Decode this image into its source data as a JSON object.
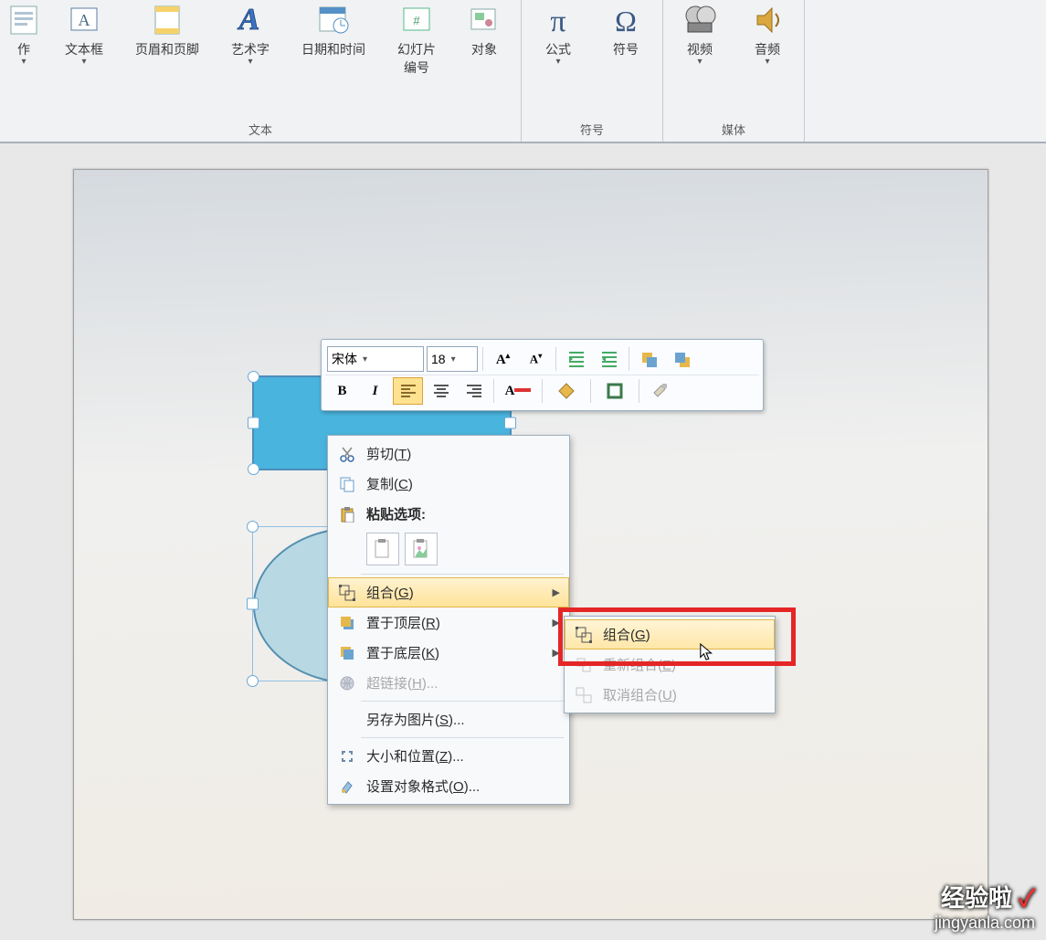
{
  "ribbon": {
    "groups": [
      {
        "label": "文本",
        "items": [
          {
            "label": "作",
            "icon": "action",
            "dd": true
          },
          {
            "label": "文本框",
            "icon": "textbox",
            "dd": true
          },
          {
            "label": "页眉和页脚",
            "icon": "headerfooter"
          },
          {
            "label": "艺术字",
            "icon": "wordart",
            "dd": true
          },
          {
            "label": "日期和时间",
            "icon": "datetime"
          },
          {
            "label": "幻灯片\n编号",
            "icon": "slidenum"
          },
          {
            "label": "对象",
            "icon": "object"
          }
        ]
      },
      {
        "label": "符号",
        "items": [
          {
            "label": "公式",
            "icon": "equation",
            "dd": true
          },
          {
            "label": "符号",
            "icon": "symbol"
          }
        ]
      },
      {
        "label": "媒体",
        "items": [
          {
            "label": "视频",
            "icon": "video",
            "dd": true
          },
          {
            "label": "音频",
            "icon": "audio",
            "dd": true
          }
        ]
      }
    ]
  },
  "mini": {
    "font": "宋体",
    "size": "18",
    "bold": "B",
    "italic": "I"
  },
  "context": {
    "cut": {
      "label": "剪切",
      "key": "T"
    },
    "copy": {
      "label": "复制",
      "key": "C"
    },
    "pasteopts": "粘贴选项:",
    "group": {
      "label": "组合",
      "key": "G"
    },
    "front": {
      "label": "置于顶层",
      "key": "R"
    },
    "back": {
      "label": "置于底层",
      "key": "K"
    },
    "hyperlink": {
      "label": "超链接",
      "key": "H",
      "suffix": "..."
    },
    "savepic": {
      "label": "另存为图片",
      "key": "S",
      "suffix": "..."
    },
    "sizepos": {
      "label": "大小和位置",
      "key": "Z",
      "suffix": "..."
    },
    "format": {
      "label": "设置对象格式",
      "key": "O",
      "suffix": "..."
    }
  },
  "submenu": {
    "group": {
      "label": "组合",
      "key": "G"
    },
    "regroup": {
      "label": "重新组合",
      "key": "E"
    },
    "ungroup": {
      "label": "取消组合",
      "key": "U"
    }
  },
  "watermark": {
    "l1": "经验啦",
    "l2": "jingyanla.com"
  }
}
